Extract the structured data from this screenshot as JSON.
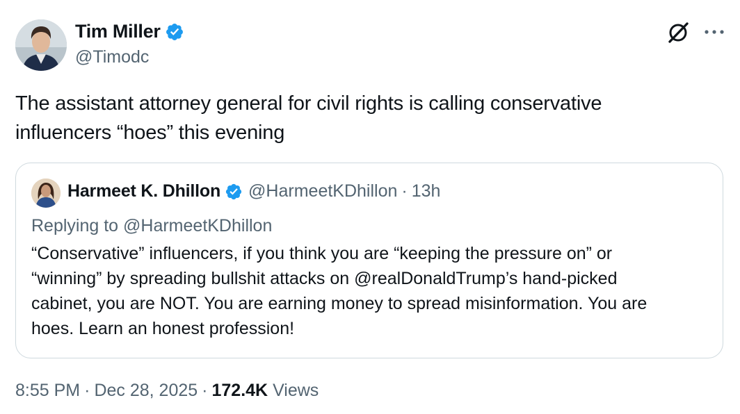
{
  "author": {
    "name": "Tim Miller",
    "handle": "@Timodc",
    "verified_color": "#1d9bf0"
  },
  "icons": {
    "grok": "grok-icon",
    "more": "more-icon",
    "verified": "verified-badge-icon"
  },
  "tweet": {
    "text": "The assistant attorney general for civil rights is calling conservative\ninfluencers “hoes” this evening"
  },
  "quote": {
    "name": "Harmeet K. Dhillon",
    "handle": "@HarmeetKDhillon",
    "separator": "·",
    "time": "13h",
    "replying_to": "Replying to @HarmeetKDhillon",
    "text": "“Conservative” influencers, if you think you are “keeping the pressure on” or\n“winning” by spreading bullshit attacks on @realDonaldTrump’s hand-picked\ncabinet, you are NOT. You are earning money to spread misinformation. You are\nhoes. Learn an honest profession!"
  },
  "meta": {
    "time": "8:55 PM",
    "separator": "·",
    "date": "Dec 28, 2025",
    "views_count": "172.4K",
    "views_label": "Views"
  },
  "colors": {
    "text_primary": "#0f1419",
    "text_secondary": "#536471",
    "border": "#cfd9de",
    "verified_blue": "#1d9bf0"
  }
}
